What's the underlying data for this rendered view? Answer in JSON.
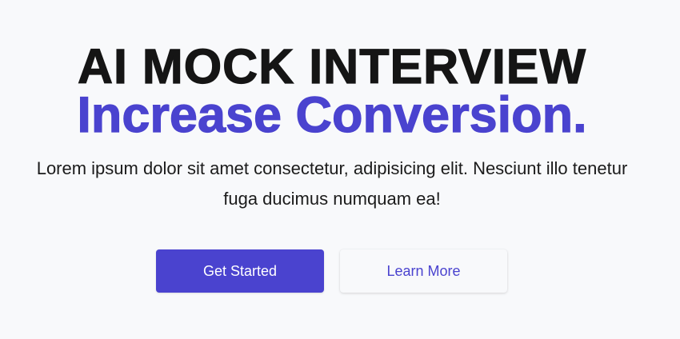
{
  "hero": {
    "headline_line1": "AI MOCK INTERVIEW",
    "headline_line2": "Increase Conversion.",
    "description": "Lorem ipsum dolor sit amet consectetur, adipisicing elit. Nesciunt illo tenetur fuga ducimus numquam ea!",
    "primary_button": "Get Started",
    "secondary_button": "Learn More"
  },
  "colors": {
    "background": "#f8f9fb",
    "accent": "#4a43cf",
    "heading": "#151515",
    "text": "#1b1b1b"
  }
}
